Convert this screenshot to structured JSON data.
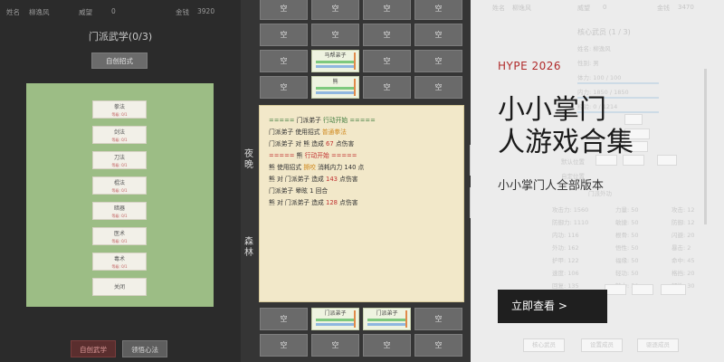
{
  "left": {
    "info": {
      "name_label": "姓名",
      "name_value": "柳逸风",
      "prestige_label": "威望",
      "prestige_value": "0",
      "money_label": "金钱",
      "money_value": "3920"
    },
    "title": "门派武学(0/3)",
    "create_btn": "自创招式",
    "skills": [
      {
        "name": "拳法",
        "level": "等级: 0/1"
      },
      {
        "name": "剑法",
        "level": "等级: 0/1"
      },
      {
        "name": "刀法",
        "level": "等级: 0/1"
      },
      {
        "name": "棍法",
        "level": "等级: 0/1"
      },
      {
        "name": "暗器",
        "level": "等级: 0/1"
      },
      {
        "name": "医术",
        "level": "等级: 0/1"
      },
      {
        "name": "毒术",
        "level": "等级: 0/1"
      }
    ],
    "close_btn": "关闭",
    "bottom_buttons": [
      "自创武学",
      "领悟心法"
    ]
  },
  "middle": {
    "side_labels": [
      "夜晚",
      "森林"
    ],
    "empty_label": "空",
    "units": {
      "horse_gang": "马帮弟子",
      "bear": "熊",
      "sect_disciple": "门派弟子"
    },
    "log": [
      {
        "parts": [
          {
            "t": "===== ",
            "c": "g"
          },
          {
            "t": "门派弟子",
            "c": ""
          },
          {
            "t": " 行动开始 =====",
            "c": "g"
          }
        ]
      },
      {
        "parts": [
          {
            "t": "门派弟子 使用招式 ",
            "c": ""
          },
          {
            "t": "普通拳法",
            "c": "o"
          }
        ]
      },
      {
        "parts": [
          {
            "t": "门派弟子 对 熊 造成 ",
            "c": ""
          },
          {
            "t": "67",
            "c": "r"
          },
          {
            "t": " 点伤害",
            "c": ""
          }
        ]
      },
      {
        "parts": [
          {
            "t": "===== ",
            "c": "r"
          },
          {
            "t": "熊",
            "c": ""
          },
          {
            "t": " 行动开始 =====",
            "c": "r"
          }
        ]
      },
      {
        "parts": [
          {
            "t": "熊 使用招式 ",
            "c": ""
          },
          {
            "t": "撕咬",
            "c": "o"
          },
          {
            "t": " 消耗内力 140 点",
            "c": ""
          }
        ]
      },
      {
        "parts": [
          {
            "t": "熊 对 门派弟子 造成 ",
            "c": ""
          },
          {
            "t": "143",
            "c": "r"
          },
          {
            "t": " 点伤害",
            "c": ""
          }
        ]
      },
      {
        "parts": [
          {
            "t": "门派弟子 晕眩 1 回合",
            "c": ""
          }
        ]
      },
      {
        "parts": [
          {
            "t": "熊 对 门派弟子 造成 ",
            "c": ""
          },
          {
            "t": "128",
            "c": "r"
          },
          {
            "t": " 点伤害",
            "c": ""
          }
        ]
      }
    ]
  },
  "right": {
    "info": {
      "name_label": "姓名",
      "name_value": "柳逸风",
      "prestige_label": "威望",
      "prestige_value": "0",
      "money_label": "金钱",
      "money_value": "3470"
    },
    "title": "核心武员 (1 / 3)",
    "fields": [
      {
        "label": "姓名: 柳逸风"
      },
      {
        "label": "性别: 男"
      },
      {
        "label": "体力: 100 / 100"
      },
      {
        "label": "内力: 1850 / 1850"
      },
      {
        "label": "经验: 0 / 1214"
      }
    ],
    "stats": [
      [
        "攻击力: 1560",
        "力量: 50",
        "攻击: 12"
      ],
      [
        "防御力: 1110",
        "敏捷: 50",
        "防御: 12"
      ],
      [
        "内功: 116",
        "根骨: 50",
        "闪避: 20"
      ],
      [
        "外功: 162",
        "悟性: 50",
        "暴击: 2"
      ],
      [
        "护甲: 122",
        "福缘: 50",
        "命中: 45"
      ],
      [
        "速度: 106",
        "轻功: 50",
        "格挡: 20"
      ],
      [
        "回复: 135",
        "魅力: 50",
        "韧性: 30"
      ]
    ],
    "misc": [
      "默认位置",
      "自定位置",
      "门派外功"
    ],
    "bottom_buttons": [
      "核心武员",
      "设置成员",
      "驱逐成员"
    ]
  },
  "promo": {
    "tag": "HYPE 2026",
    "title_line1": "小小掌门",
    "title_line2": "人游戏合集",
    "subtitle": "小小掌门人全部版本",
    "cta": "立即查看 >"
  },
  "colors": {
    "accent_red": "#b02a2a",
    "cta_bg": "#1f1f1f",
    "green_panel": "#9cbd85",
    "log_bg": "#f2e8c9"
  }
}
